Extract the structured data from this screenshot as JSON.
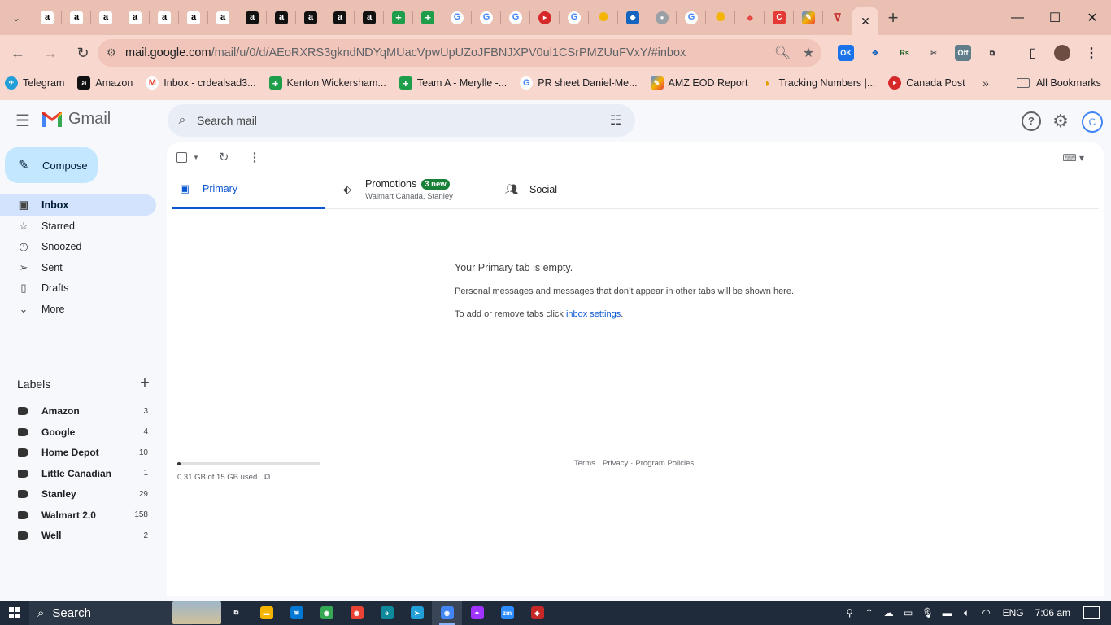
{
  "browser": {
    "tab_favicons": [
      "a",
      "a",
      "a",
      "a",
      "a",
      "a",
      "a",
      "a",
      "a",
      "a",
      "a",
      "a",
      "+",
      "+",
      "G",
      "G",
      "G",
      "▸",
      "G",
      "✺",
      "◆",
      "●",
      "G",
      "✺",
      "⌖",
      "C",
      "✎",
      "⊽"
    ],
    "active_tab_close": "✕",
    "new_tab": "+",
    "window_controls": {
      "minimize": "—",
      "maximize": "☐",
      "close": "✕"
    },
    "url_host": "mail.google.com",
    "url_path": "/mail/u/0/d/AEoRXRS3gkndNDYqMUacVpwUpUZoJFBNJXPV0ul1CSrPMZUuFVxY/#inbox",
    "extensions": [
      "OK",
      "✥",
      "Rs",
      "✂",
      "Off",
      "⧉"
    ],
    "bookmarks": [
      {
        "icon": "telegram",
        "label": "Telegram"
      },
      {
        "icon": "amazon",
        "label": "Amazon"
      },
      {
        "icon": "gmail",
        "label": "Inbox - crdealsad3..."
      },
      {
        "icon": "sheets",
        "label": "Kenton Wickersham..."
      },
      {
        "icon": "sheets",
        "label": "Team A - Merylle -..."
      },
      {
        "icon": "google",
        "label": "PR sheet Daniel-Me..."
      },
      {
        "icon": "rainbow",
        "label": "AMZ EOD Report"
      },
      {
        "icon": "taco",
        "label": "Tracking Numbers |..."
      },
      {
        "icon": "canada-post",
        "label": "Canada Post"
      }
    ],
    "all_bookmarks": "All Bookmarks"
  },
  "gmail": {
    "logo_text": "Gmail",
    "search_placeholder": "Search mail",
    "account_initial": "C",
    "compose_label": "Compose",
    "nav": [
      {
        "label": "Inbox",
        "icon": "inbox-icon",
        "active": true
      },
      {
        "label": "Starred",
        "icon": "star-icon"
      },
      {
        "label": "Snoozed",
        "icon": "clock-icon"
      },
      {
        "label": "Sent",
        "icon": "send-icon"
      },
      {
        "label": "Drafts",
        "icon": "draft-icon"
      },
      {
        "label": "More",
        "icon": "chevron-down-icon"
      }
    ],
    "labels_heading": "Labels",
    "labels": [
      {
        "name": "Amazon",
        "count": "3"
      },
      {
        "name": "Google",
        "count": "4"
      },
      {
        "name": "Home Depot",
        "count": "10"
      },
      {
        "name": "Little Canadian",
        "count": "1"
      },
      {
        "name": "Stanley",
        "count": "29"
      },
      {
        "name": "Walmart 2.0",
        "count": "158"
      },
      {
        "name": "Well",
        "count": "2"
      }
    ],
    "tabs": {
      "primary": "Primary",
      "promotions": "Promotions",
      "promotions_badge": "3 new",
      "promotions_senders": "Walmart Canada, Stanley",
      "social": "Social"
    },
    "empty": {
      "title": "Your Primary tab is empty.",
      "description": "Personal messages and messages that don’t appear in other tabs will be shown here.",
      "settings_prefix": "To add or remove tabs click ",
      "settings_link": "inbox settings",
      "settings_suffix": "."
    },
    "storage": {
      "text": "0.31 GB of 15 GB used",
      "used_fraction": 0.02
    },
    "footer": {
      "terms": "Terms",
      "privacy": "Privacy",
      "policies": "Program Policies",
      "separator": "·"
    }
  },
  "taskbar": {
    "search_label": "Search",
    "apps": [
      {
        "name": "task-view",
        "glyph": "⧉",
        "color": "#1f2b3a"
      },
      {
        "name": "file-explorer",
        "glyph": "▬",
        "color": "#f4b400"
      },
      {
        "name": "mail",
        "glyph": "✉",
        "color": "#0078d4"
      },
      {
        "name": "chrome",
        "glyph": "◉",
        "color": "#34a853"
      },
      {
        "name": "chrome-2",
        "glyph": "◉",
        "color": "#ea4335"
      },
      {
        "name": "edge",
        "glyph": "e",
        "color": "#0f8a9c"
      },
      {
        "name": "telegram",
        "glyph": "➤",
        "color": "#229ed9"
      },
      {
        "name": "chrome-active",
        "glyph": "◉",
        "color": "#4285f4"
      },
      {
        "name": "messenger",
        "glyph": "✦",
        "color": "#a033ff"
      },
      {
        "name": "zoom",
        "glyph": "zm",
        "color": "#2d8cff"
      },
      {
        "name": "other-app",
        "glyph": "◆",
        "color": "#c62828"
      }
    ],
    "language": "ENG",
    "time": "7:06 am"
  }
}
